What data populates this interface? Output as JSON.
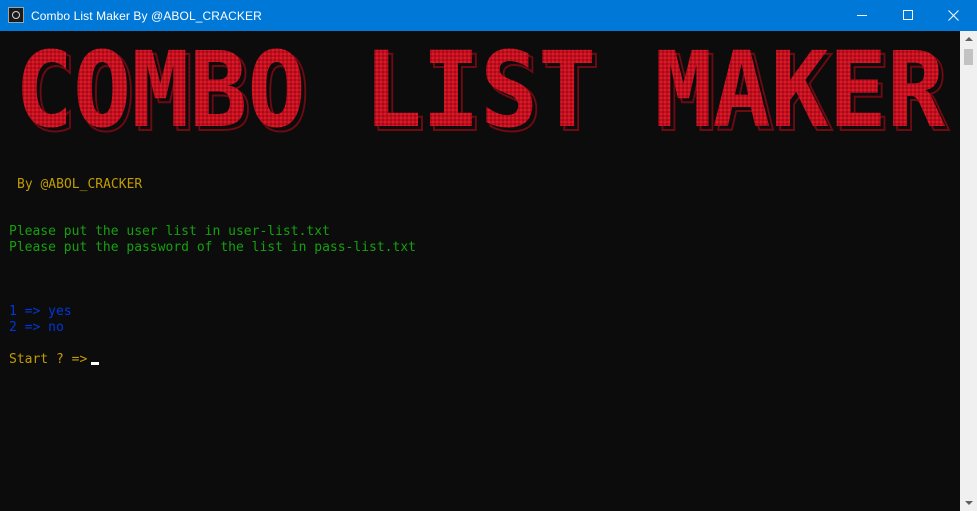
{
  "window": {
    "title": "Combo List Maker By @ABOL_CRACKER",
    "app_icon": "console-icon",
    "controls": {
      "minimize_icon": "minimize-icon",
      "maximize_icon": "maximize-icon",
      "close_icon": "close-icon"
    }
  },
  "console": {
    "banner_text": "COMBO LIST MAKER",
    "author": "By @ABOL_CRACKER",
    "instructions": [
      "Please put the user list in user-list.txt",
      "Please put the password of the list in pass-list.txt"
    ],
    "options": [
      "1 => yes",
      "2 => no"
    ],
    "prompt": "Start ? =>"
  },
  "colors": {
    "titlebar": "#0078d7",
    "background": "#0c0c0c",
    "banner_red": "#c50f1f",
    "author": "#c19c00",
    "instructions": "#13a10e",
    "options": "#0037da",
    "prompt": "#c19c00"
  }
}
